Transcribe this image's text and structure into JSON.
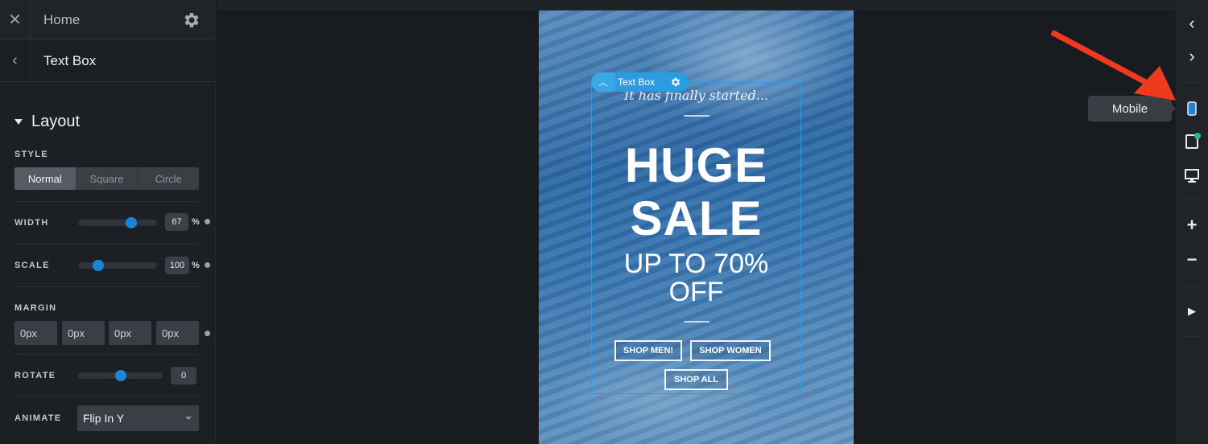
{
  "panel": {
    "home_label": "Home",
    "current_label": "Text Box",
    "section_title": "Layout",
    "style": {
      "label": "STYLE",
      "options": [
        "Normal",
        "Square",
        "Circle"
      ],
      "selected": "Normal"
    },
    "width": {
      "label": "WIDTH",
      "value": "67",
      "unit": "%",
      "fraction": 0.67
    },
    "scale": {
      "label": "SCALE",
      "value": "100",
      "unit": "%",
      "fraction": 0.25
    },
    "margin": {
      "label": "MARGIN",
      "values": [
        "0px",
        "0px",
        "0px",
        "0px"
      ]
    },
    "rotate": {
      "label": "ROTATE",
      "value": "0",
      "fraction": 0.5
    },
    "animate": {
      "label": "ANIMATE",
      "value": "Flip In Y"
    }
  },
  "canvas": {
    "toolbar_label": "Text Box",
    "script_text": "It has finally started...",
    "headline_1": "HUGE",
    "headline_2": "SALE",
    "subhead_1": "UP TO 70%",
    "subhead_2": "OFF",
    "buttons": [
      "SHOP MEN!",
      "SHOP WOMEN",
      "SHOP ALL"
    ]
  },
  "rail": {
    "tooltip": "Mobile",
    "icons": [
      "chevron-left-icon",
      "chevron-right-icon",
      "mobile-icon",
      "tablet-icon",
      "desktop-icon",
      "zoom-in-icon",
      "zoom-out-icon",
      "play-icon"
    ]
  },
  "colors": {
    "accent": "#1d85d6",
    "selection": "#2a9be4",
    "status_green": "#22c07a",
    "annotation_arrow": "#f03a1f"
  }
}
